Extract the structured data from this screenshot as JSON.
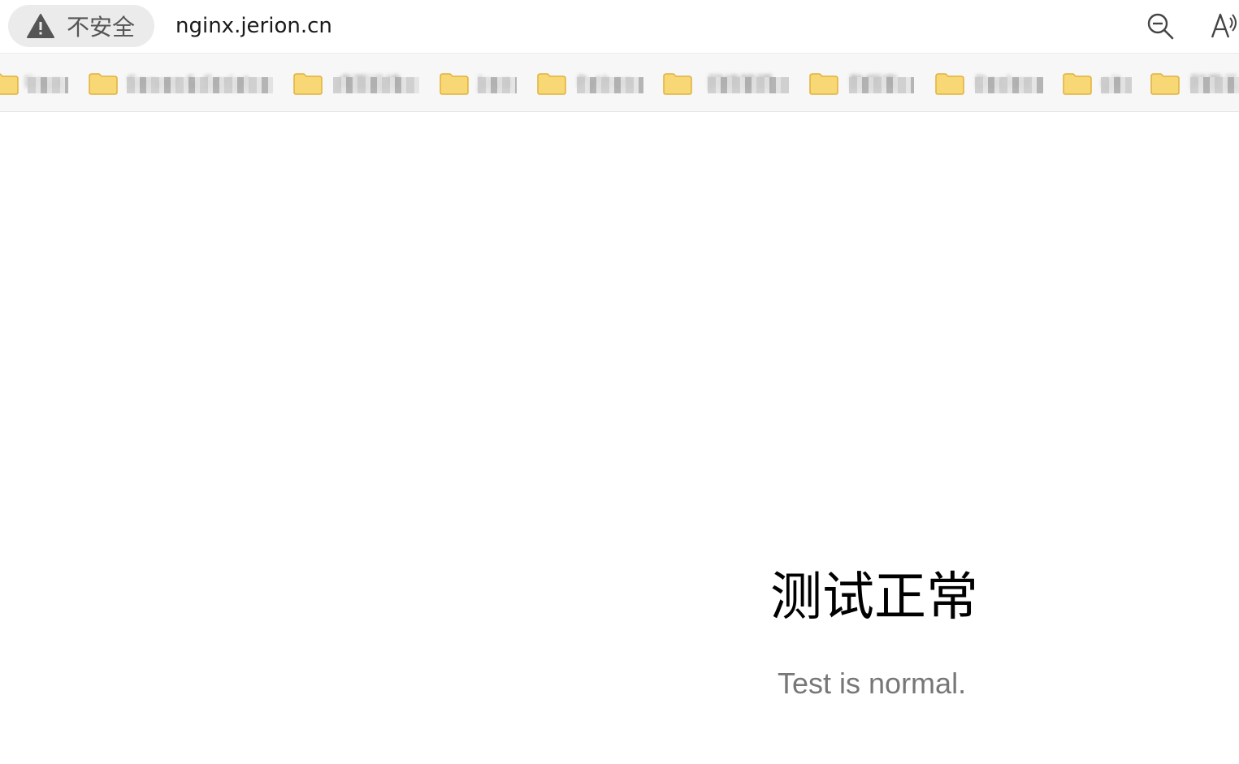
{
  "browser": {
    "security_label": "不安全",
    "url": "nginx.jerion.cn",
    "icons": [
      "warning-icon",
      "zoom-out-icon",
      "read-aloud-icon"
    ]
  },
  "bookmarks": [
    {
      "label": "linux",
      "icon": "folder-icon"
    },
    {
      "label": "Server & Script",
      "icon": "folder-icon"
    },
    {
      "label": "桌面运维",
      "icon": "folder-icon"
    },
    {
      "label": "Java",
      "icon": "folder-icon"
    },
    {
      "label": "Python",
      "icon": "folder-icon"
    },
    {
      "label": "网络管理",
      "icon": "folder-icon"
    },
    {
      "label": "数据库",
      "icon": "folder-icon"
    },
    {
      "label": "Docker",
      "icon": "folder-icon"
    },
    {
      "label": "git",
      "icon": "folder-icon"
    },
    {
      "label": "阿里云",
      "icon": "folder-icon"
    }
  ],
  "page": {
    "title": "测试正常",
    "subtitle": "Test is normal."
  },
  "colors": {
    "folder": "#f8d775",
    "folder_edge": "#e0b23d",
    "pill_bg": "#ebebeb",
    "subtitle": "#777777"
  }
}
